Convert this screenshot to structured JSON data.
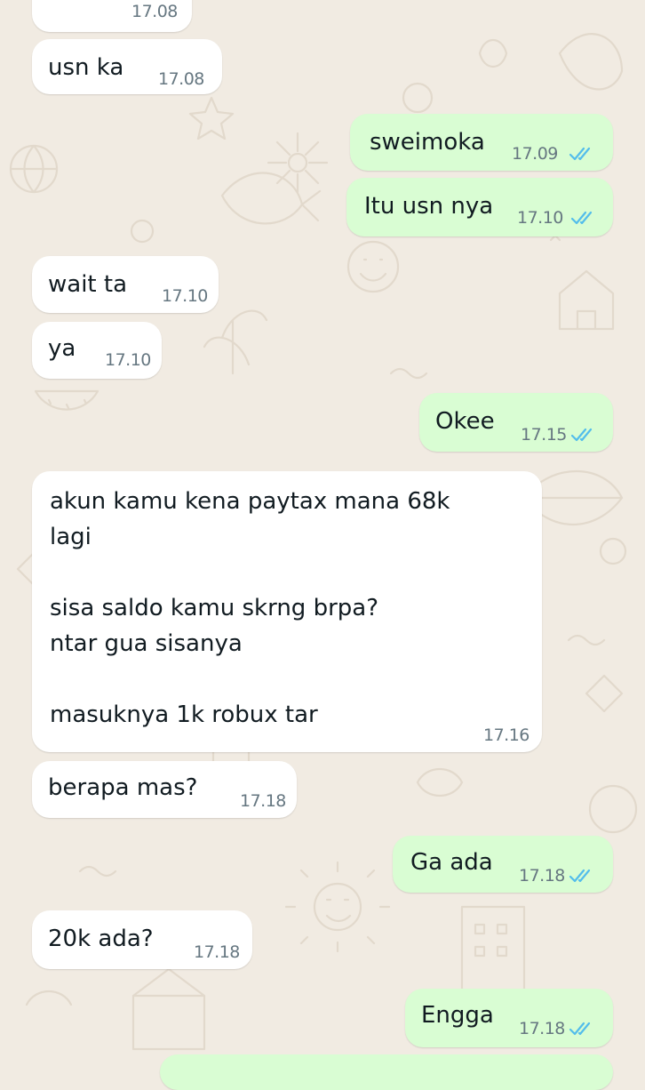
{
  "messages": [
    {
      "dir": "in",
      "text": "",
      "time": "17.08"
    },
    {
      "dir": "in",
      "text": "usn ka",
      "time": "17.08"
    },
    {
      "dir": "out",
      "text": "sweimoka",
      "time": "17.09",
      "read": true
    },
    {
      "dir": "out",
      "text": "Itu usn nya",
      "time": "17.10",
      "read": true
    },
    {
      "dir": "in",
      "text": "wait ta",
      "time": "17.10"
    },
    {
      "dir": "in",
      "text": "ya",
      "time": "17.10"
    },
    {
      "dir": "out",
      "text": "Okee",
      "time": "17.15",
      "read": true
    },
    {
      "dir": "in",
      "text": "akun kamu kena paytax mana 68k\nlagi\n\nsisa saldo kamu skrng brpa?\nntar gua sisanya\n\nmasuknya 1k robux tar",
      "time": "17.16"
    },
    {
      "dir": "in",
      "text": "berapa mas?",
      "time": "17.18"
    },
    {
      "dir": "out",
      "text": "Ga ada",
      "time": "17.18",
      "read": true
    },
    {
      "dir": "in",
      "text": "20k ada?",
      "time": "17.18"
    },
    {
      "dir": "out",
      "text": "Engga",
      "time": "17.18",
      "read": true
    },
    {
      "dir": "out",
      "text": "",
      "time": ""
    }
  ],
  "colors": {
    "wallpaper": "#f1ebe2",
    "incoming_bubble": "#ffffff",
    "outgoing_bubble": "#d9fdd3",
    "read_ticks": "#53bdeb",
    "time_text": "#667781"
  },
  "icons": {
    "read_receipt": "double-check-icon"
  }
}
